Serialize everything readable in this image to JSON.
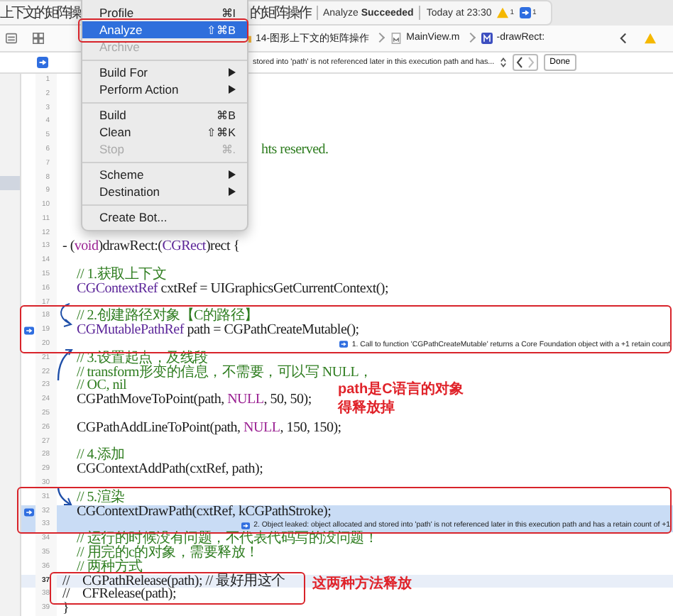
{
  "toolbar": {
    "activity_left": "上下文的矩阵操",
    "activity_right": "的矩阵操作",
    "status": "Analyze **Succeeded**",
    "time": "Today at 23:30",
    "warnings": "1",
    "analyzer_issues": "1"
  },
  "jump_bar": {
    "items": [
      {
        "kind": "folder",
        "label": "14-图形上下文的矩阵操作"
      },
      {
        "kind": "file",
        "label": "MainView.m"
      },
      {
        "kind": "method",
        "label": "-drawRect:"
      }
    ]
  },
  "issue_bar": {
    "message": "stored into 'path' is not referenced later in this execution path and has...",
    "done": "Done"
  },
  "menu": {
    "groups": [
      [
        {
          "label": "Profile",
          "shortcut": "⌘I",
          "submenu": false,
          "disabled": false,
          "selected": false
        },
        {
          "label": "Analyze",
          "shortcut": "⇧⌘B",
          "submenu": false,
          "disabled": false,
          "selected": true
        },
        {
          "label": "Archive",
          "submenu": false,
          "disabled": true,
          "selected": false
        }
      ],
      [
        {
          "label": "Build For",
          "submenu": true,
          "disabled": false,
          "selected": false
        },
        {
          "label": "Perform Action",
          "submenu": true,
          "disabled": false,
          "selected": false
        }
      ],
      [
        {
          "label": "Build",
          "shortcut": "⌘B",
          "submenu": false,
          "disabled": false,
          "selected": false
        },
        {
          "label": "Clean",
          "shortcut": "⇧⌘K",
          "submenu": false,
          "disabled": false,
          "selected": false
        },
        {
          "label": "Stop",
          "shortcut": "⌘.",
          "submenu": false,
          "disabled": true,
          "selected": false
        }
      ],
      [
        {
          "label": "Scheme",
          "submenu": true,
          "disabled": false,
          "selected": false
        },
        {
          "label": "Destination",
          "submenu": true,
          "disabled": false,
          "selected": false
        }
      ],
      [
        {
          "label": "Create Bot...",
          "submenu": false,
          "disabled": false,
          "selected": false
        }
      ]
    ]
  },
  "lines": [
    {
      "number": "1",
      "kind": "code"
    },
    {
      "number": "2",
      "kind": "code"
    },
    {
      "number": "3",
      "kind": "code"
    },
    {
      "number": "4",
      "kind": "code"
    },
    {
      "number": "5",
      "kind": "code"
    },
    {
      "number": "6",
      "kind": "partial",
      "tokens": [
        {
          "text": "hts reserved.",
          "kind": "comment"
        }
      ]
    },
    {
      "number": "7",
      "kind": "code"
    },
    {
      "number": "8",
      "kind": "code"
    },
    {
      "number": "9",
      "kind": "code"
    },
    {
      "number": "10",
      "kind": "code"
    },
    {
      "number": "11",
      "kind": "code"
    },
    {
      "number": "12",
      "kind": "code"
    },
    {
      "number": "13",
      "kind": "code",
      "tokens": [
        {
          "text": "- (",
          "kind": "plain"
        },
        {
          "text": "void",
          "kind": "keyword"
        },
        {
          "text": ")drawRect:(",
          "kind": "plain"
        },
        {
          "text": "CGRect",
          "kind": "type"
        },
        {
          "text": ")rect {",
          "kind": "plain"
        }
      ]
    },
    {
      "number": "14",
      "kind": "code"
    },
    {
      "number": "15",
      "kind": "code",
      "indented": true,
      "tokens": [
        {
          "text": "// 1.获取上下文",
          "kind": "comment"
        }
      ]
    },
    {
      "number": "16",
      "kind": "code",
      "indented": true,
      "tokens": [
        {
          "text": "CGContextRef",
          "kind": "type"
        },
        {
          "text": " cxtRef = UIGraphicsGetCurrentContext();",
          "kind": "plain"
        }
      ]
    },
    {
      "number": "17",
      "kind": "code"
    },
    {
      "number": "18",
      "kind": "code",
      "indented": true,
      "tokens": [
        {
          "text": "// 2.创建路径对象【C的路径】",
          "kind": "comment"
        }
      ]
    },
    {
      "number": "19",
      "kind": "code",
      "indented": true,
      "marker": true,
      "tokens": [
        {
          "text": "CGMutablePathRef",
          "kind": "type"
        },
        {
          "text": " path = CGPathCreateMutable();",
          "kind": "plain"
        }
      ]
    },
    {
      "number": "20",
      "kind": "message",
      "message": "1. Call to function 'CGPathCreateMutable' returns a Core Foundation object with a +1 retain count"
    },
    {
      "number": "21",
      "kind": "code",
      "indented": true,
      "tokens": [
        {
          "text": "// 3.设置起点，及线段",
          "kind": "comment"
        }
      ]
    },
    {
      "number": "22",
      "kind": "code",
      "indented": true,
      "tokens": [
        {
          "text": "// transform形变的信息，不需要，可以写 NULL，",
          "kind": "comment"
        }
      ]
    },
    {
      "number": "23",
      "kind": "code",
      "indented": true,
      "tokens": [
        {
          "text": "// OC, nil",
          "kind": "comment"
        }
      ]
    },
    {
      "number": "24",
      "kind": "code",
      "indented": true,
      "tokens": [
        {
          "text": "CGPathMoveToPoint(path, ",
          "kind": "plain"
        },
        {
          "text": "NULL",
          "kind": "keyword"
        },
        {
          "text": ", 50, 50);",
          "kind": "plain"
        }
      ]
    },
    {
      "number": "25",
      "kind": "code"
    },
    {
      "number": "26",
      "kind": "code",
      "indented": true,
      "tokens": [
        {
          "text": "CGPathAddLineToPoint(path, ",
          "kind": "plain"
        },
        {
          "text": "NULL",
          "kind": "keyword"
        },
        {
          "text": ", 150, 150);",
          "kind": "plain"
        }
      ]
    },
    {
      "number": "27",
      "kind": "code"
    },
    {
      "number": "28",
      "kind": "code",
      "indented": true,
      "tokens": [
        {
          "text": "// 4.添加",
          "kind": "comment"
        }
      ]
    },
    {
      "number": "29",
      "kind": "code",
      "indented": true,
      "tokens": [
        {
          "text": "CGContextAddPath(cxtRef, path);",
          "kind": "plain"
        }
      ]
    },
    {
      "number": "30",
      "kind": "code"
    },
    {
      "number": "31",
      "kind": "code",
      "indented": true,
      "tokens": [
        {
          "text": "// 5.渲染",
          "kind": "comment"
        }
      ]
    },
    {
      "number": "32",
      "kind": "code",
      "indented": true,
      "marker": true,
      "highlighted": true,
      "tokens": [
        {
          "text": "CGContextDrawPath(cxtRef, kCGPathStroke);",
          "kind": "plain"
        }
      ]
    },
    {
      "number": "33",
      "kind": "message",
      "highlighted": true,
      "message": "2. Object leaked: object allocated and stored into 'path' is not referenced later in this execution path and has a retain count of +1"
    },
    {
      "number": "34",
      "kind": "code",
      "indented": true,
      "tokens": [
        {
          "text": "// 运行的时候没有问题，不代表代码写的没问题！",
          "kind": "comment"
        }
      ]
    },
    {
      "number": "35",
      "kind": "code",
      "indented": true,
      "tokens": [
        {
          "text": "// 用完的c的对象，需要释放！",
          "kind": "comment"
        }
      ]
    },
    {
      "number": "36",
      "kind": "code",
      "indented": true,
      "tokens": [
        {
          "text": "// 两种方式",
          "kind": "comment"
        }
      ]
    },
    {
      "number": "37",
      "kind": "code",
      "current": true,
      "tokens": [
        {
          "text": "//    CGPathRelease(path); // 最好用这个",
          "kind": "plain"
        }
      ]
    },
    {
      "number": "38",
      "kind": "code",
      "tokens": [
        {
          "text": "//    CFRelease(path);",
          "kind": "plain"
        }
      ]
    },
    {
      "number": "39",
      "kind": "code",
      "tokens": [
        {
          "text": "}",
          "kind": "plain"
        }
      ]
    }
  ],
  "notes": [
    {
      "lines": [
        "path是C语言的对象",
        "得释放掉"
      ]
    },
    {
      "lines": [
        "这两种方法释放"
      ]
    }
  ]
}
